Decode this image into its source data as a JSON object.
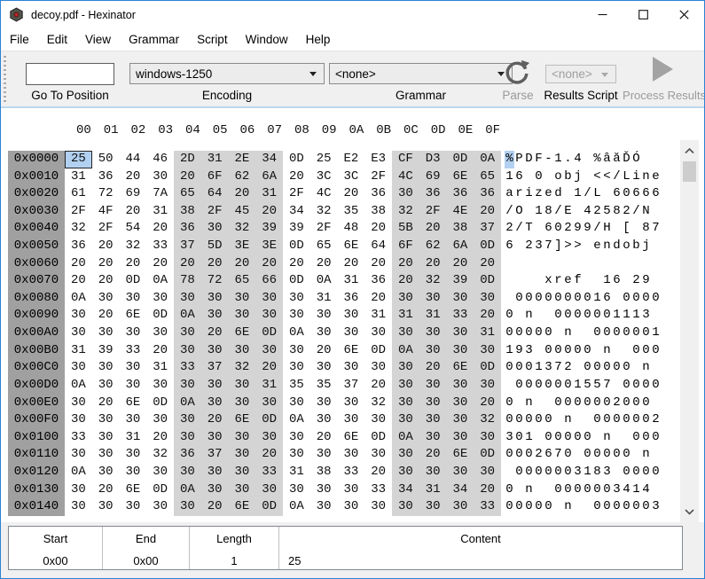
{
  "window": {
    "title": "decoy.pdf - Hexinator"
  },
  "menu": {
    "items": [
      "File",
      "Edit",
      "View",
      "Grammar",
      "Script",
      "Window",
      "Help"
    ]
  },
  "toolbar": {
    "goto": {
      "value": "",
      "label": "Go To Position"
    },
    "encoding": {
      "value": "windows-1250",
      "label": "Encoding"
    },
    "grammar": {
      "value": "<none>",
      "label": "Grammar"
    },
    "parse": {
      "label": "Parse"
    },
    "results_script": {
      "value": "<none>",
      "label": "Results Script"
    },
    "process_results": {
      "label": "Process Results"
    }
  },
  "hexview": {
    "column_headers": [
      "00",
      "01",
      "02",
      "03",
      "04",
      "05",
      "06",
      "07",
      "08",
      "09",
      "0A",
      "0B",
      "0C",
      "0D",
      "0E",
      "0F"
    ],
    "selection": {
      "row": 0,
      "byte": 0
    },
    "rows": [
      {
        "addr": "0x0000",
        "bytes": [
          "25",
          "50",
          "44",
          "46",
          "2D",
          "31",
          "2E",
          "34",
          "0D",
          "25",
          "E2",
          "E3",
          "CF",
          "D3",
          "0D",
          "0A"
        ],
        "text": "%PDF-1.4 %âăĎÓ  "
      },
      {
        "addr": "0x0010",
        "bytes": [
          "31",
          "36",
          "20",
          "30",
          "20",
          "6F",
          "62",
          "6A",
          "20",
          "3C",
          "3C",
          "2F",
          "4C",
          "69",
          "6E",
          "65"
        ],
        "text": "16 0 obj <</Line"
      },
      {
        "addr": "0x0020",
        "bytes": [
          "61",
          "72",
          "69",
          "7A",
          "65",
          "64",
          "20",
          "31",
          "2F",
          "4C",
          "20",
          "36",
          "30",
          "36",
          "36",
          "36"
        ],
        "text": "arized 1/L 60666"
      },
      {
        "addr": "0x0030",
        "bytes": [
          "2F",
          "4F",
          "20",
          "31",
          "38",
          "2F",
          "45",
          "20",
          "34",
          "32",
          "35",
          "38",
          "32",
          "2F",
          "4E",
          "20"
        ],
        "text": "/O 18/E 42582/N "
      },
      {
        "addr": "0x0040",
        "bytes": [
          "32",
          "2F",
          "54",
          "20",
          "36",
          "30",
          "32",
          "39",
          "39",
          "2F",
          "48",
          "20",
          "5B",
          "20",
          "38",
          "37"
        ],
        "text": "2/T 60299/H [ 87"
      },
      {
        "addr": "0x0050",
        "bytes": [
          "36",
          "20",
          "32",
          "33",
          "37",
          "5D",
          "3E",
          "3E",
          "0D",
          "65",
          "6E",
          "64",
          "6F",
          "62",
          "6A",
          "0D"
        ],
        "text": "6 237]>> endobj "
      },
      {
        "addr": "0x0060",
        "bytes": [
          "20",
          "20",
          "20",
          "20",
          "20",
          "20",
          "20",
          "20",
          "20",
          "20",
          "20",
          "20",
          "20",
          "20",
          "20",
          "20"
        ],
        "text": "                "
      },
      {
        "addr": "0x0070",
        "bytes": [
          "20",
          "20",
          "0D",
          "0A",
          "78",
          "72",
          "65",
          "66",
          "0D",
          "0A",
          "31",
          "36",
          "20",
          "32",
          "39",
          "0D"
        ],
        "text": "    xref  16 29 "
      },
      {
        "addr": "0x0080",
        "bytes": [
          "0A",
          "30",
          "30",
          "30",
          "30",
          "30",
          "30",
          "30",
          "30",
          "31",
          "36",
          "20",
          "30",
          "30",
          "30",
          "30"
        ],
        "text": " 0000000016 0000"
      },
      {
        "addr": "0x0090",
        "bytes": [
          "30",
          "20",
          "6E",
          "0D",
          "0A",
          "30",
          "30",
          "30",
          "30",
          "30",
          "30",
          "31",
          "31",
          "31",
          "33",
          "20"
        ],
        "text": "0 n  0000001113 "
      },
      {
        "addr": "0x00A0",
        "bytes": [
          "30",
          "30",
          "30",
          "30",
          "30",
          "20",
          "6E",
          "0D",
          "0A",
          "30",
          "30",
          "30",
          "30",
          "30",
          "30",
          "31"
        ],
        "text": "00000 n  0000001"
      },
      {
        "addr": "0x00B0",
        "bytes": [
          "31",
          "39",
          "33",
          "20",
          "30",
          "30",
          "30",
          "30",
          "30",
          "20",
          "6E",
          "0D",
          "0A",
          "30",
          "30",
          "30"
        ],
        "text": "193 00000 n  000"
      },
      {
        "addr": "0x00C0",
        "bytes": [
          "30",
          "30",
          "30",
          "31",
          "33",
          "37",
          "32",
          "20",
          "30",
          "30",
          "30",
          "30",
          "30",
          "20",
          "6E",
          "0D"
        ],
        "text": "0001372 00000 n "
      },
      {
        "addr": "0x00D0",
        "bytes": [
          "0A",
          "30",
          "30",
          "30",
          "30",
          "30",
          "30",
          "31",
          "35",
          "35",
          "37",
          "20",
          "30",
          "30",
          "30",
          "30"
        ],
        "text": " 0000001557 0000"
      },
      {
        "addr": "0x00E0",
        "bytes": [
          "30",
          "20",
          "6E",
          "0D",
          "0A",
          "30",
          "30",
          "30",
          "30",
          "30",
          "30",
          "32",
          "30",
          "30",
          "30",
          "20"
        ],
        "text": "0 n  0000002000 "
      },
      {
        "addr": "0x00F0",
        "bytes": [
          "30",
          "30",
          "30",
          "30",
          "30",
          "20",
          "6E",
          "0D",
          "0A",
          "30",
          "30",
          "30",
          "30",
          "30",
          "30",
          "32"
        ],
        "text": "00000 n  0000002"
      },
      {
        "addr": "0x0100",
        "bytes": [
          "33",
          "30",
          "31",
          "20",
          "30",
          "30",
          "30",
          "30",
          "30",
          "20",
          "6E",
          "0D",
          "0A",
          "30",
          "30",
          "30"
        ],
        "text": "301 00000 n  000"
      },
      {
        "addr": "0x0110",
        "bytes": [
          "30",
          "30",
          "30",
          "32",
          "36",
          "37",
          "30",
          "20",
          "30",
          "30",
          "30",
          "30",
          "30",
          "20",
          "6E",
          "0D"
        ],
        "text": "0002670 00000 n "
      },
      {
        "addr": "0x0120",
        "bytes": [
          "0A",
          "30",
          "30",
          "30",
          "30",
          "30",
          "30",
          "33",
          "31",
          "38",
          "33",
          "20",
          "30",
          "30",
          "30",
          "30"
        ],
        "text": " 0000003183 0000"
      },
      {
        "addr": "0x0130",
        "bytes": [
          "30",
          "20",
          "6E",
          "0D",
          "0A",
          "30",
          "30",
          "30",
          "30",
          "30",
          "30",
          "33",
          "34",
          "31",
          "34",
          "20"
        ],
        "text": "0 n  0000003414 "
      },
      {
        "addr": "0x0140",
        "bytes": [
          "30",
          "30",
          "30",
          "30",
          "30",
          "20",
          "6E",
          "0D",
          "0A",
          "30",
          "30",
          "30",
          "30",
          "30",
          "30",
          "33"
        ],
        "text": "00000 n  0000003"
      }
    ]
  },
  "statusbar": {
    "columns": [
      {
        "header": "Start",
        "value": "0x00"
      },
      {
        "header": "End",
        "value": "0x00"
      },
      {
        "header": "Length",
        "value": "1"
      },
      {
        "header": "Content",
        "value": "25"
      }
    ]
  },
  "colors": {
    "window_border": "#2a82d4",
    "selection_fill": "#b2d1f1",
    "address_column_bg": "#a0a0a0",
    "shaded_group_bg": "#d4d4d4",
    "toolbar_bg": "#f0f0f0",
    "scroll_thumb": "#cdcdcd"
  }
}
